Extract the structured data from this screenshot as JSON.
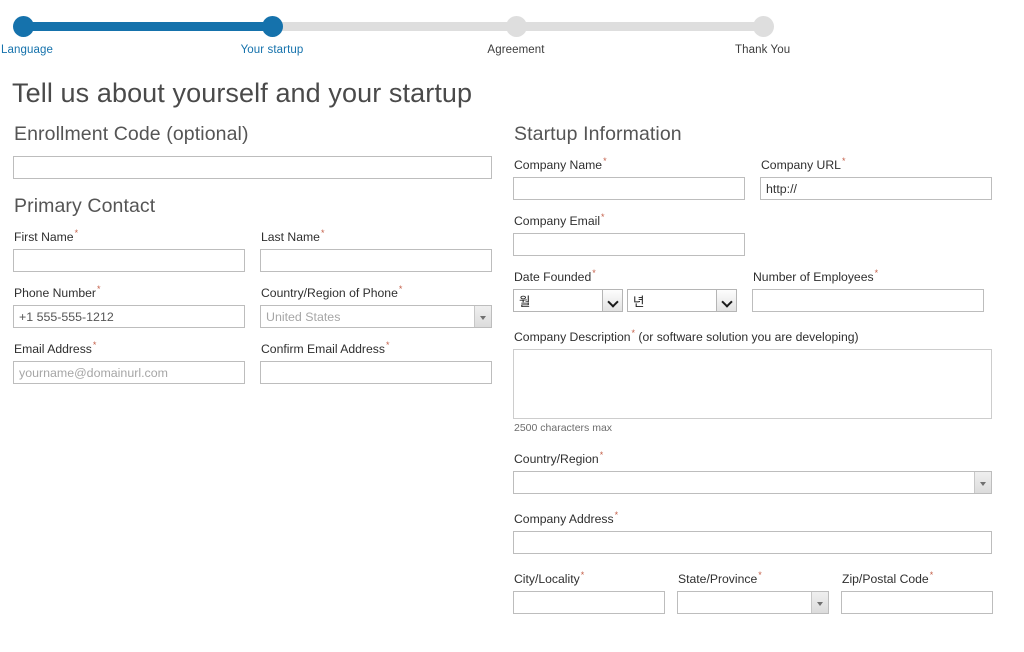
{
  "stepper": {
    "steps": [
      {
        "label": "Language",
        "state": "done"
      },
      {
        "label": "Your startup",
        "state": "current"
      },
      {
        "label": "Agreement",
        "state": "upcoming"
      },
      {
        "label": "Thank You",
        "state": "upcoming"
      }
    ],
    "accent_color": "#1572ac",
    "track_color": "#dedede"
  },
  "page": {
    "title": "Tell us about yourself and your startup"
  },
  "left": {
    "enrollment": {
      "section_title": "Enrollment Code (optional)",
      "code": {
        "label": "Enrollment Code (optional)",
        "value": "",
        "placeholder": ""
      }
    },
    "primary_contact": {
      "section_title": "Primary Contact",
      "first_name": {
        "label": "First Name",
        "required": "*",
        "value": "",
        "placeholder": ""
      },
      "last_name": {
        "label": "Last Name",
        "required": "*",
        "value": "",
        "placeholder": ""
      },
      "phone_number": {
        "label": "Phone Number",
        "required": "*",
        "value": "",
        "placeholder": "+1 555-555-1212"
      },
      "country_of_phone": {
        "label": "Country/Region of Phone",
        "required": "*",
        "value": "",
        "placeholder": "United States"
      },
      "email": {
        "label": "Email Address",
        "required": "*",
        "value": "",
        "placeholder": "yourname@domainurl.com"
      },
      "confirm_email": {
        "label": "Confirm Email Address",
        "required": "*",
        "value": "",
        "placeholder": ""
      }
    }
  },
  "right": {
    "section_title": "Startup Information",
    "company_name": {
      "label": "Company Name",
      "required": "*",
      "value": "",
      "placeholder": ""
    },
    "company_url": {
      "label": "Company URL",
      "required": "*",
      "value": "http://",
      "placeholder": ""
    },
    "company_email": {
      "label": "Company Email",
      "required": "*",
      "value": "",
      "placeholder": ""
    },
    "date_founded": {
      "label": "Date Founded",
      "required": "*",
      "month": {
        "selected": "월"
      },
      "year": {
        "selected": "년"
      }
    },
    "number_of_employees": {
      "label": "Number of Employees",
      "required": "*",
      "value": "",
      "placeholder": ""
    },
    "company_description": {
      "label": "Company Description",
      "required": "*",
      "label_suffix": " (or software solution you are developing)",
      "value": "",
      "placeholder": "",
      "hint": "2500 characters max"
    },
    "country_region": {
      "label": "Country/Region",
      "required": "*",
      "value": "",
      "placeholder": ""
    },
    "company_address": {
      "label": "Company Address",
      "required": "*",
      "value": "",
      "placeholder": ""
    },
    "city": {
      "label": "City/Locality",
      "required": "*",
      "value": "",
      "placeholder": ""
    },
    "state": {
      "label": "State/Province",
      "required": "*",
      "value": "",
      "placeholder": ""
    },
    "zip": {
      "label": "Zip/Postal Code",
      "required": "*",
      "value": "",
      "placeholder": ""
    }
  }
}
